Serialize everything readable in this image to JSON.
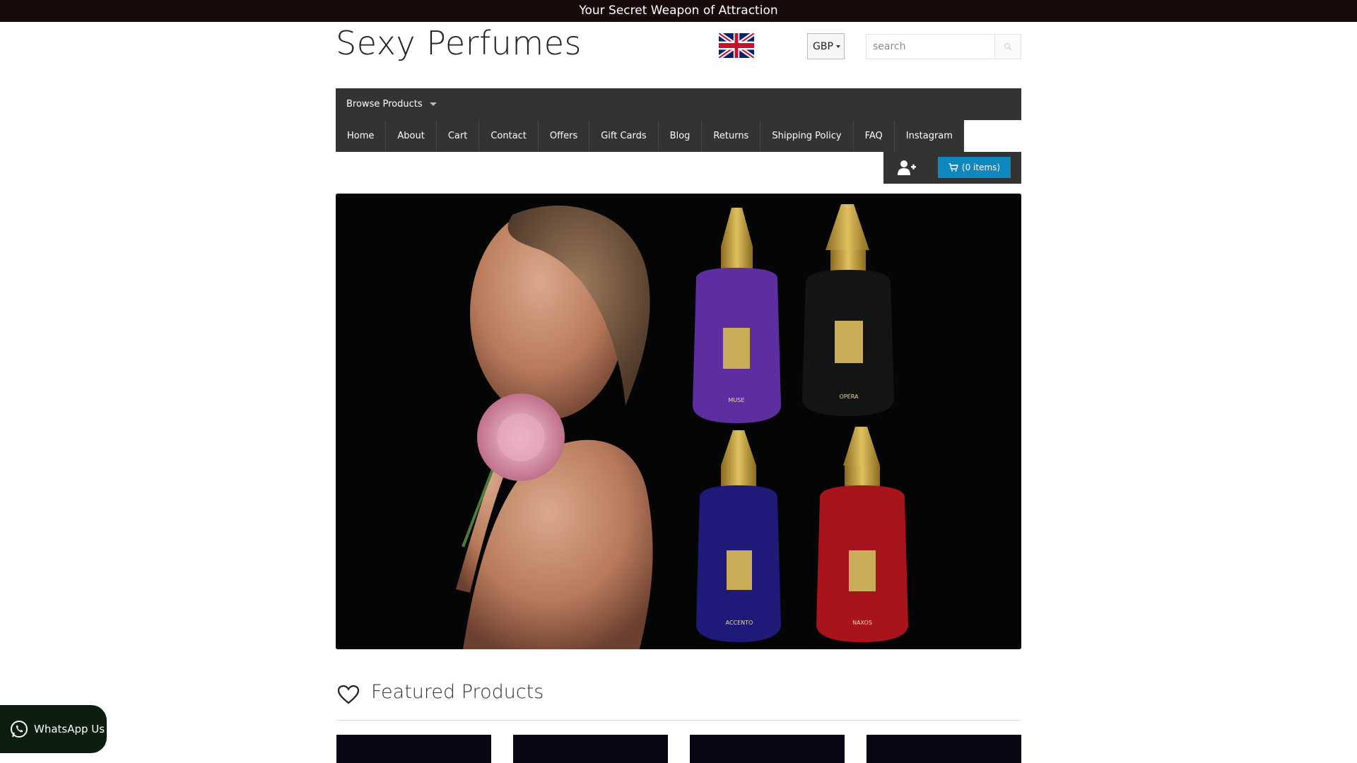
{
  "announcement": "Your Secret Weapon of Attraction",
  "site": {
    "logo": "Sexy Perfumes"
  },
  "header": {
    "flag": "uk-flag-icon",
    "currency": "GBP",
    "search": {
      "placeholder": "search",
      "value": ""
    }
  },
  "nav": {
    "browse_label": "Browse Products",
    "items": [
      {
        "label": "Home"
      },
      {
        "label": "About"
      },
      {
        "label": "Cart"
      },
      {
        "label": "Contact"
      },
      {
        "label": "Offers"
      },
      {
        "label": "Gift Cards"
      },
      {
        "label": "Blog"
      },
      {
        "label": "Returns"
      },
      {
        "label": "Shipping Policy"
      },
      {
        "label": "FAQ"
      },
      {
        "label": "Instagram"
      }
    ]
  },
  "account": {
    "cart_label": "(0 items)"
  },
  "hero": {
    "bottle_labels": [
      "MUSE",
      "OPERA",
      "ACCENTO",
      "NAXOS"
    ]
  },
  "featured": {
    "title": "Featured Products"
  },
  "whatsapp": {
    "label": "WhatsApp Us"
  },
  "colors": {
    "topbar_bg": "#1a0b0b",
    "nav_bg": "#333333",
    "cart_button": "#1187c0",
    "whatsapp_bg": "#0c1e10",
    "product_thumb": "#070716"
  }
}
